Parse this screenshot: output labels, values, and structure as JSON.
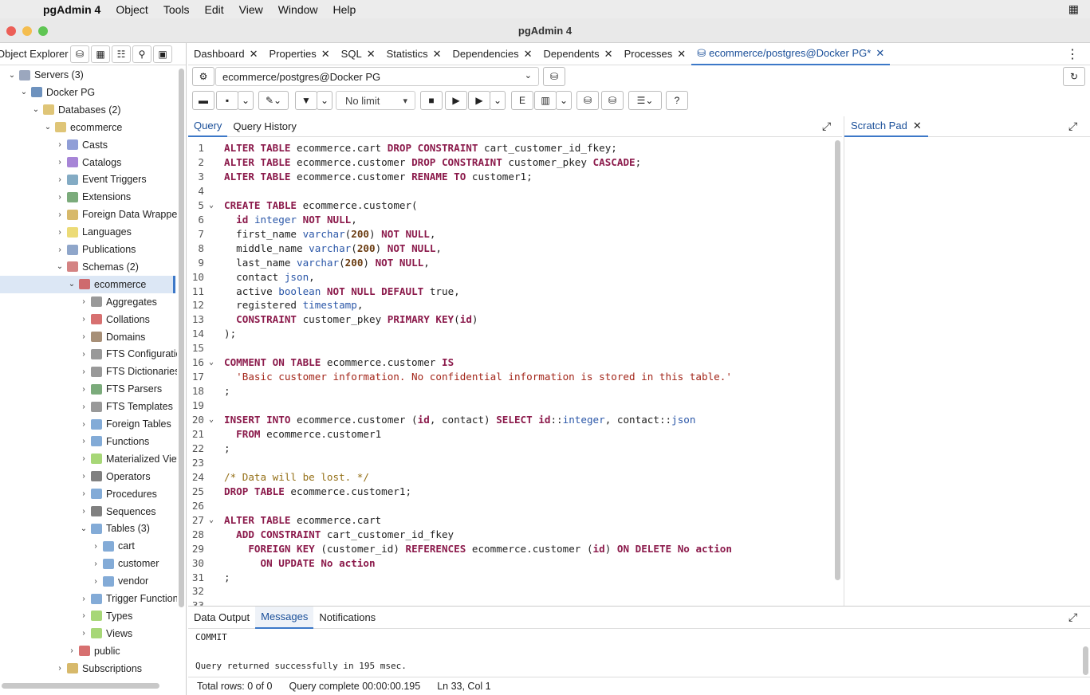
{
  "menubar": {
    "app": "pgAdmin 4",
    "items": [
      "Object",
      "Tools",
      "Edit",
      "View",
      "Window",
      "Help"
    ]
  },
  "window": {
    "title": "pgAdmin 4"
  },
  "left_panel": {
    "title": "Object Explorer"
  },
  "tree": [
    {
      "label": "Servers (3)",
      "depth": 0,
      "caret": "open",
      "icon": "server-group-icon",
      "color": "#7a8aa8"
    },
    {
      "label": "Docker PG",
      "depth": 1,
      "caret": "open",
      "icon": "postgres-server-icon",
      "color": "#3d6ea8"
    },
    {
      "label": "Databases (2)",
      "depth": 2,
      "caret": "open",
      "icon": "databases-icon",
      "color": "#d4b14a"
    },
    {
      "label": "ecommerce",
      "depth": 3,
      "caret": "open",
      "icon": "database-icon",
      "color": "#d4b14a"
    },
    {
      "label": "Casts",
      "depth": 4,
      "caret": "closed",
      "icon": "casts-icon",
      "color": "#6b7ec9"
    },
    {
      "label": "Catalogs",
      "depth": 4,
      "caret": "closed",
      "icon": "catalogs-icon",
      "color": "#8a5cc9"
    },
    {
      "label": "Event Triggers",
      "depth": 4,
      "caret": "closed",
      "icon": "event-trigger-icon",
      "color": "#5a8fb0"
    },
    {
      "label": "Extensions",
      "depth": 4,
      "caret": "closed",
      "icon": "extensions-icon",
      "color": "#4f8f4f"
    },
    {
      "label": "Foreign Data Wrappers",
      "depth": 4,
      "caret": "closed",
      "icon": "fdw-icon",
      "color": "#c9a13a"
    },
    {
      "label": "Languages",
      "depth": 4,
      "caret": "closed",
      "icon": "languages-icon",
      "color": "#e6cf4a"
    },
    {
      "label": "Publications",
      "depth": 4,
      "caret": "closed",
      "icon": "publications-icon",
      "color": "#6a88b8"
    },
    {
      "label": "Schemas (2)",
      "depth": 4,
      "caret": "open",
      "icon": "schemas-icon",
      "color": "#c65a5a"
    },
    {
      "label": "ecommerce",
      "depth": 5,
      "caret": "open",
      "icon": "schema-icon",
      "color": "#c94040"
    },
    {
      "label": "Aggregates",
      "depth": 6,
      "caret": "closed",
      "icon": "aggregates-icon",
      "color": "#777777"
    },
    {
      "label": "Collations",
      "depth": 6,
      "caret": "closed",
      "icon": "collations-icon",
      "color": "#c94040"
    },
    {
      "label": "Domains",
      "depth": 6,
      "caret": "closed",
      "icon": "domains-icon",
      "color": "#8a6a4a"
    },
    {
      "label": "FTS Configuration",
      "depth": 6,
      "caret": "closed",
      "icon": "fts-config-icon",
      "color": "#777777"
    },
    {
      "label": "FTS Dictionaries",
      "depth": 6,
      "caret": "closed",
      "icon": "fts-dictionaries-icon",
      "color": "#777777"
    },
    {
      "label": "FTS Parsers",
      "depth": 6,
      "caret": "closed",
      "icon": "fts-parsers-icon",
      "color": "#4f8f4f"
    },
    {
      "label": "FTS Templates",
      "depth": 6,
      "caret": "closed",
      "icon": "fts-templates-icon",
      "color": "#777777"
    },
    {
      "label": "Foreign Tables",
      "depth": 6,
      "caret": "closed",
      "icon": "foreign-tables-icon",
      "color": "#5a8fc9"
    },
    {
      "label": "Functions",
      "depth": 6,
      "caret": "closed",
      "icon": "functions-icon",
      "color": "#5a8fc9"
    },
    {
      "label": "Materialized Views",
      "depth": 6,
      "caret": "closed",
      "icon": "mviews-icon",
      "color": "#8ac94a"
    },
    {
      "label": "Operators",
      "depth": 6,
      "caret": "closed",
      "icon": "operators-icon",
      "color": "#555555"
    },
    {
      "label": "Procedures",
      "depth": 6,
      "caret": "closed",
      "icon": "procedures-icon",
      "color": "#5a8fc9"
    },
    {
      "label": "Sequences",
      "depth": 6,
      "caret": "closed",
      "icon": "sequences-icon",
      "color": "#555555"
    },
    {
      "label": "Tables (3)",
      "depth": 6,
      "caret": "open",
      "icon": "tables-icon",
      "color": "#5a8fc9"
    },
    {
      "label": "cart",
      "depth": 7,
      "caret": "closed",
      "icon": "table-icon",
      "color": "#5a8fc9"
    },
    {
      "label": "customer",
      "depth": 7,
      "caret": "closed",
      "icon": "table-icon",
      "color": "#5a8fc9"
    },
    {
      "label": "vendor",
      "depth": 7,
      "caret": "closed",
      "icon": "table-icon",
      "color": "#5a8fc9"
    },
    {
      "label": "Trigger Functions",
      "depth": 6,
      "caret": "closed",
      "icon": "trigger-functions-icon",
      "color": "#5a8fc9"
    },
    {
      "label": "Types",
      "depth": 6,
      "caret": "closed",
      "icon": "types-icon",
      "color": "#8ac94a"
    },
    {
      "label": "Views",
      "depth": 6,
      "caret": "closed",
      "icon": "views-icon",
      "color": "#8ac94a"
    },
    {
      "label": "public",
      "depth": 5,
      "caret": "closed",
      "icon": "schema-icon",
      "color": "#c94040"
    },
    {
      "label": "Subscriptions",
      "depth": 4,
      "caret": "closed",
      "icon": "subscriptions-icon",
      "color": "#c9a13a"
    }
  ],
  "tabs": [
    {
      "label": "Dashboard",
      "close": "✕"
    },
    {
      "label": "Properties",
      "close": "✕"
    },
    {
      "label": "SQL",
      "close": "✕"
    },
    {
      "label": "Statistics",
      "close": "✕"
    },
    {
      "label": "Dependencies",
      "close": "✕"
    },
    {
      "label": "Dependents",
      "close": "✕"
    },
    {
      "label": "Processes",
      "close": "✕"
    },
    {
      "label": "ecommerce/postgres@Docker PG*",
      "close": "✕",
      "active": true
    }
  ],
  "connection": {
    "value": "ecommerce/postgres@Docker PG"
  },
  "toolbar": {
    "limit": "No limit"
  },
  "query_tabs": [
    "Query",
    "Query History"
  ],
  "scratch_pad": {
    "title": "Scratch Pad"
  },
  "editor_lines": [
    "<span class=\"kw\">ALTER TABLE</span> ecommerce.cart <span class=\"kw\">DROP CONSTRAINT</span> cart_customer_id_fkey;",
    "<span class=\"kw\">ALTER TABLE</span> ecommerce.customer <span class=\"kw\">DROP CONSTRAINT</span> customer_pkey <span class=\"kw\">CASCADE</span>;",
    "<span class=\"kw\">ALTER TABLE</span> ecommerce.customer <span class=\"kw\">RENAME TO</span> customer1;",
    "",
    "<span class=\"kw\">CREATE TABLE</span> ecommerce.customer(",
    "  <span class=\"kw\">id</span> <span class=\"ty\">integer</span> <span class=\"kw\">NOT NULL</span>,",
    "  first_name <span class=\"ty\">varchar</span>(<span class=\"nm\">200</span>) <span class=\"kw\">NOT NULL</span>,",
    "  middle_name <span class=\"ty\">varchar</span>(<span class=\"nm\">200</span>) <span class=\"kw\">NOT NULL</span>,",
    "  last_name <span class=\"ty\">varchar</span>(<span class=\"nm\">200</span>) <span class=\"kw\">NOT NULL</span>,",
    "  contact <span class=\"ty\">json</span>,",
    "  active <span class=\"ty\">boolean</span> <span class=\"kw\">NOT NULL DEFAULT</span> true,",
    "  registered <span class=\"ty\">timestamp</span>,",
    "  <span class=\"kw\">CONSTRAINT</span> customer_pkey <span class=\"kw\">PRIMARY KEY</span>(<span class=\"kw\">id</span>)",
    ");",
    "",
    "<span class=\"kw\">COMMENT ON TABLE</span> ecommerce.customer <span class=\"kw\">IS</span>",
    "  <span class=\"st\">'Basic customer information. No confidential information is stored in this table.'</span>",
    ";",
    "",
    "<span class=\"kw\">INSERT INTO</span> ecommerce.customer (<span class=\"kw\">id</span>, contact) <span class=\"kw\">SELECT id</span>::<span class=\"ty\">integer</span>, contact::<span class=\"ty\">json</span>",
    "  <span class=\"kw\">FROM</span> ecommerce.customer1",
    ";",
    "",
    "<span class=\"cm\">/* Data will be lost. */</span>",
    "<span class=\"kw\">DROP TABLE</span> ecommerce.customer1;",
    "",
    "<span class=\"kw\">ALTER TABLE</span> ecommerce.cart",
    "  <span class=\"kw\">ADD CONSTRAINT</span> cart_customer_id_fkey",
    "    <span class=\"kw\">FOREIGN KEY</span> (customer_id) <span class=\"kw\">REFERENCES</span> ecommerce.customer (<span class=\"kw\">id</span>) <span class=\"kw\">ON DELETE No action</span>",
    "      <span class=\"kw\">ON UPDATE No action</span>",
    ";",
    "",
    ""
  ],
  "folds": [
    5,
    16,
    20,
    27
  ],
  "bottom_tabs": [
    "Data Output",
    "Messages",
    "Notifications"
  ],
  "messages": {
    "line1": "COMMIT",
    "line2": "Query returned successfully in 195 msec."
  },
  "status": {
    "rows": "Total rows: 0 of 0",
    "complete": "Query complete 00:00:00.195",
    "cursor": "Ln 33, Col 1"
  }
}
